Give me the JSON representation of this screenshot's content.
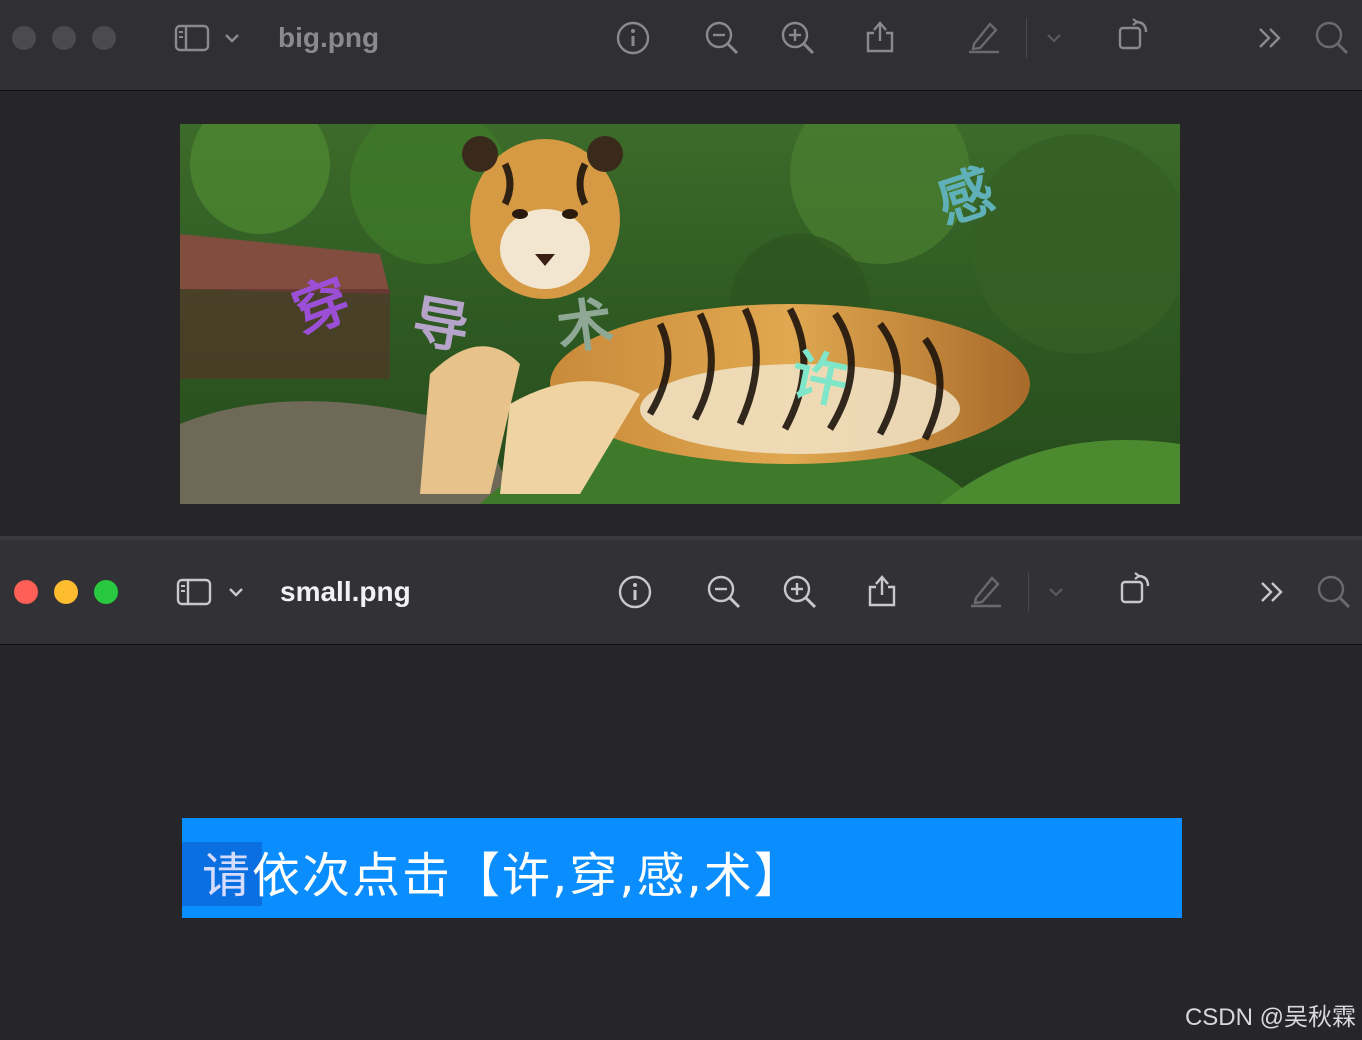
{
  "windows": {
    "big": {
      "title": "big.png"
    },
    "small": {
      "title": "small.png"
    }
  },
  "captcha": {
    "instruction_first": "请",
    "instruction_rest": "依次点击【许,穿,感,术】",
    "overlay_chars": [
      {
        "char": "穿",
        "color": "#9b4fd6"
      },
      {
        "char": "导",
        "color": "#b5a3c9"
      },
      {
        "char": "术",
        "color": "#8fa896"
      },
      {
        "char": "许",
        "color": "#7fe6c9"
      },
      {
        "char": "感",
        "color": "#5fb0b8"
      }
    ]
  },
  "toolbar_icons": [
    "sidebar-icon",
    "chevron-down-icon",
    "info-icon",
    "zoom-out-icon",
    "zoom-in-icon",
    "share-icon",
    "markup-pen-icon",
    "chevron-down-icon",
    "rotate-icon",
    "more-chevrons-icon",
    "search-icon"
  ],
  "colors": {
    "accent": "#0a8dff",
    "bg": "#262628",
    "titlebar": "#303034"
  },
  "watermark": "CSDN @吴秋霖"
}
